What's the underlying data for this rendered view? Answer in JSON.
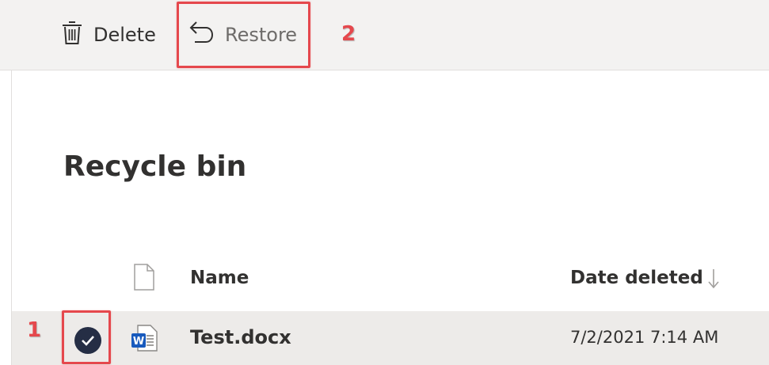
{
  "toolbar": {
    "delete_label": "Delete",
    "restore_label": "Restore",
    "delete_icon": "trash-icon",
    "restore_icon": "undo-arrow-icon"
  },
  "page": {
    "title": "Recycle bin"
  },
  "table": {
    "columns": [
      {
        "label": "Name"
      },
      {
        "label": "Date deleted",
        "sort": "descending"
      }
    ],
    "rows": [
      {
        "name": "Test.docx",
        "date_deleted": "7/2/2021 7:14 AM",
        "file_icon": "word-document-icon",
        "selected": true
      }
    ]
  },
  "annotations": {
    "step1": "1",
    "step2": "2",
    "color": "#e5484d"
  },
  "colors": {
    "toolbar_bg": "#f3f2f1",
    "selected_row_bg": "#edebe9",
    "check_bg": "#252e45",
    "word_blue": "#185abd"
  }
}
